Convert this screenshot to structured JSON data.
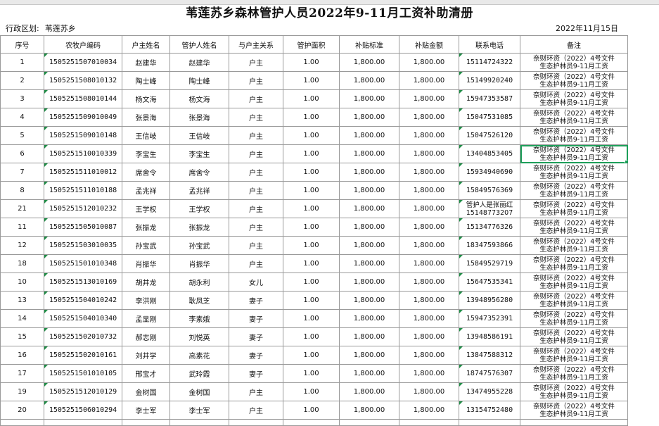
{
  "title": "苇莲苏乡森林管护人员2022年9-11月工资补助清册",
  "meta": {
    "region_label": "行政区划:",
    "region_value": "苇莲苏乡",
    "date": "2022年11月15日"
  },
  "headers": [
    "序号",
    "农牧户编码",
    "户主姓名",
    "管护人姓名",
    "与户主关系",
    "管护面积",
    "补贴标准",
    "补贴金额",
    "联系电话",
    "备注"
  ],
  "remark_line1": "奈财环资（2022）4号文件",
  "remark_line2": "生态护林员9-11月工资",
  "rows": [
    {
      "no": "1",
      "code": "150525150701003​4",
      "head": "赵建华",
      "keeper": "赵建华",
      "rel": "户主",
      "area": "1.00",
      "std": "1,800.00",
      "amt": "1,800.00",
      "phone": "15114724322"
    },
    {
      "no": "2",
      "code": "1505251508010132",
      "head": "陶士峰",
      "keeper": "陶士峰",
      "rel": "户主",
      "area": "1.00",
      "std": "1,800.00",
      "amt": "1,800.00",
      "phone": "15149920240"
    },
    {
      "no": "3",
      "code": "1505251508010144",
      "head": "杨文海",
      "keeper": "杨文海",
      "rel": "户主",
      "area": "1.00",
      "std": "1,800.00",
      "amt": "1,800.00",
      "phone": "15947353587"
    },
    {
      "no": "4",
      "code": "1505251509010049",
      "head": "张景海",
      "keeper": "张景海",
      "rel": "户主",
      "area": "1.00",
      "std": "1,800.00",
      "amt": "1,800.00",
      "phone": "15047531085"
    },
    {
      "no": "5",
      "code": "1505251509010148",
      "head": "王信岐",
      "keeper": "王信岐",
      "rel": "户主",
      "area": "1.00",
      "std": "1,800.00",
      "amt": "1,800.00",
      "phone": "15047526120"
    },
    {
      "no": "6",
      "code": "1505251510010339",
      "head": "李宝生",
      "keeper": "李宝生",
      "rel": "户主",
      "area": "1.00",
      "std": "1,800.00",
      "amt": "1,800.00",
      "phone": "13404853405"
    },
    {
      "no": "7",
      "code": "1505251511010012",
      "head": "席舍令",
      "keeper": "席舍令",
      "rel": "户主",
      "area": "1.00",
      "std": "1,800.00",
      "amt": "1,800.00",
      "phone": "15934940690"
    },
    {
      "no": "8",
      "code": "1505251511010188",
      "head": "孟兆祥",
      "keeper": "孟兆祥",
      "rel": "户主",
      "area": "1.00",
      "std": "1,800.00",
      "amt": "1,800.00",
      "phone": "15849576369"
    },
    {
      "no": "21",
      "code": "1505251512010232",
      "head": "王学权",
      "keeper": "王学权",
      "rel": "户主",
      "area": "1.00",
      "std": "1,800.00",
      "amt": "1,800.00",
      "phone_line1": "管护人是张丽红",
      "phone_line2": "15148773207"
    },
    {
      "no": "11",
      "code": "1505251505010087",
      "head": "张振龙",
      "keeper": "张振龙",
      "rel": "户主",
      "area": "1.00",
      "std": "1,800.00",
      "amt": "1,800.00",
      "phone": "15134776326"
    },
    {
      "no": "12",
      "code": "1505251503010035",
      "head": "孙宝武",
      "keeper": "孙宝武",
      "rel": "户主",
      "area": "1.00",
      "std": "1,800.00",
      "amt": "1,800.00",
      "phone": "18347593866"
    },
    {
      "no": "18",
      "code": "1505251501010348",
      "head": "肖振华",
      "keeper": "肖振华",
      "rel": "户主",
      "area": "1.00",
      "std": "1,800.00",
      "amt": "1,800.00",
      "phone": "15849529719"
    },
    {
      "no": "10",
      "code": "1505251513010169",
      "head": "胡井龙",
      "keeper": "胡永利",
      "rel": "女儿",
      "area": "1.00",
      "std": "1,800.00",
      "amt": "1,800.00",
      "phone": "15647535341"
    },
    {
      "no": "13",
      "code": "1505251504010242",
      "head": "李洪刚",
      "keeper": "耿凤芝",
      "rel": "妻子",
      "area": "1.00",
      "std": "1,800.00",
      "amt": "1,800.00",
      "phone": "13948956280"
    },
    {
      "no": "14",
      "code": "1505251504010340",
      "head": "孟显刚",
      "keeper": "李素娥",
      "rel": "妻子",
      "area": "1.00",
      "std": "1,800.00",
      "amt": "1,800.00",
      "phone": "15947352391"
    },
    {
      "no": "15",
      "code": "1505251502010732",
      "head": "郝志刚",
      "keeper": "刘悦英",
      "rel": "妻子",
      "area": "1.00",
      "std": "1,800.00",
      "amt": "1,800.00",
      "phone": "13948586191"
    },
    {
      "no": "16",
      "code": "1505251502010161",
      "head": "刘井学",
      "keeper": "高素花",
      "rel": "妻子",
      "area": "1.00",
      "std": "1,800.00",
      "amt": "1,800.00",
      "phone": "13847588312"
    },
    {
      "no": "17",
      "code": "1505251501010105",
      "head": "邢宝才",
      "keeper": "武玲霞",
      "rel": "妻子",
      "area": "1.00",
      "std": "1,800.00",
      "amt": "1,800.00",
      "phone": "18747576307"
    },
    {
      "no": "19",
      "code": "1505251512010129",
      "head": "金树国",
      "keeper": "金树国",
      "rel": "户主",
      "area": "1.00",
      "std": "1,800.00",
      "amt": "1,800.00",
      "phone": "13474955228"
    },
    {
      "no": "20",
      "code": "1505251506010294",
      "head": "李士军",
      "keeper": "李士军",
      "rel": "户主",
      "area": "1.00",
      "std": "1,800.00",
      "amt": "1,800.00",
      "phone": "13154752480"
    }
  ],
  "colors": {
    "grid": "#9a9a9a",
    "selection": "#1e9f5a",
    "tick": "#1e8c45"
  }
}
